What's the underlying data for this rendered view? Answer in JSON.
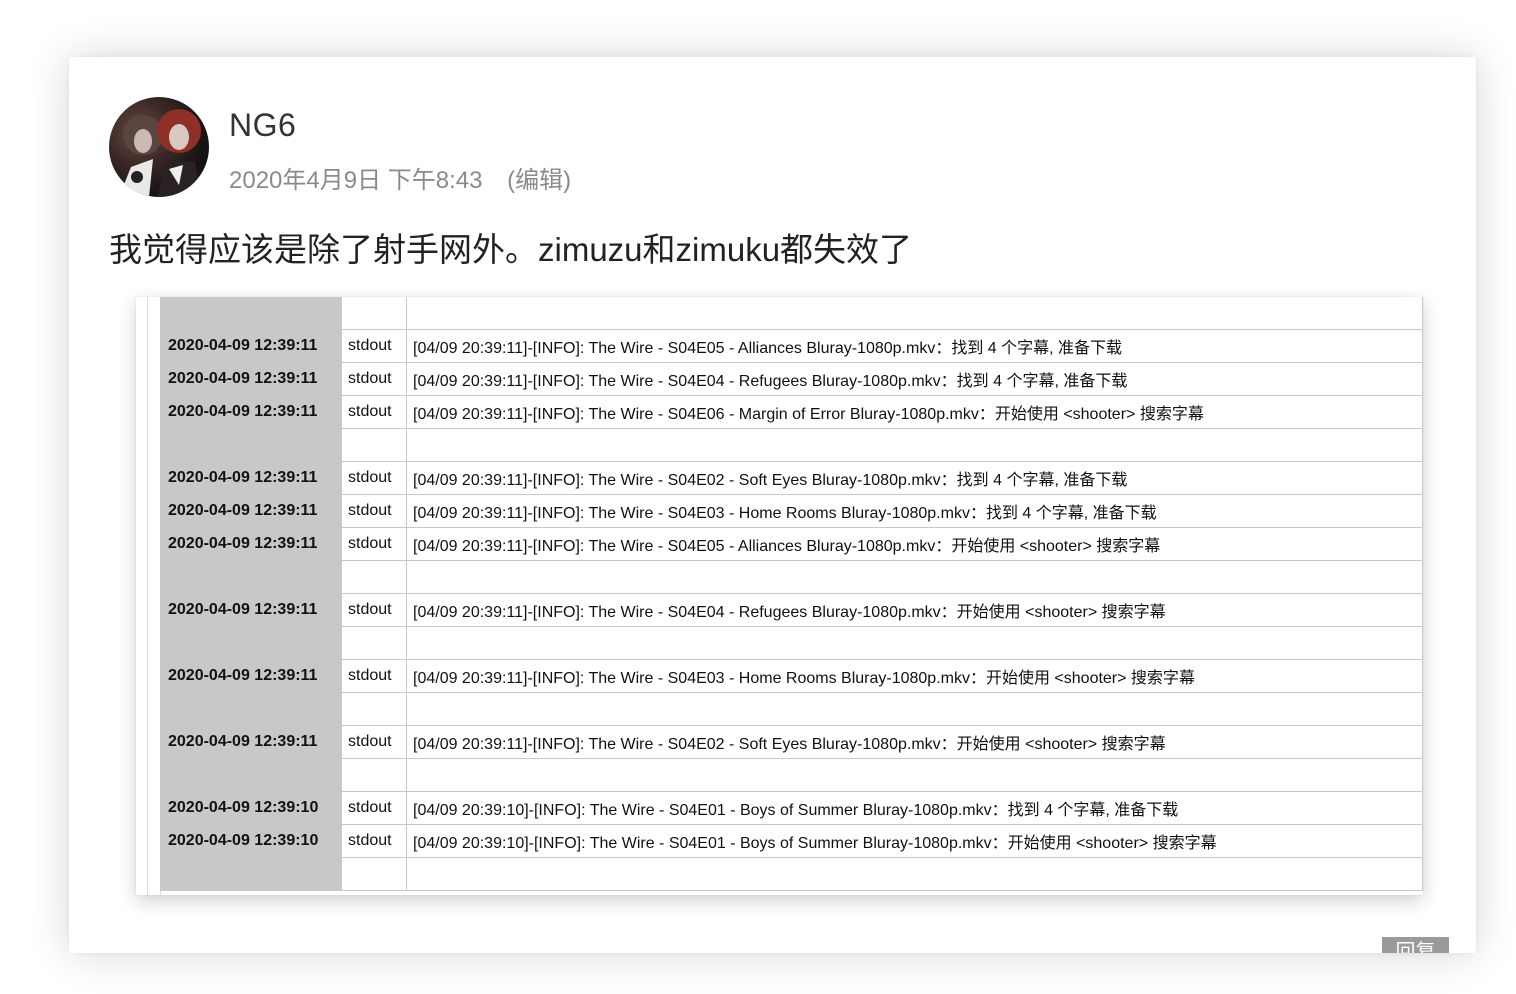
{
  "post": {
    "username": "NG6",
    "timestamp": "2020年4月9日 下午8:43",
    "edit_label": "(编辑)",
    "comment": "我觉得应该是除了射手网外。zimuzu和zimuku都失效了",
    "reply_label": "回复"
  },
  "log_rows": [
    {
      "ts": "",
      "src": "",
      "msg": ""
    },
    {
      "ts": "2020-04-09 12:39:11",
      "src": "stdout",
      "msg": "[04/09 20:39:11]-[INFO]: The Wire - S04E05 - Alliances Bluray-1080p.mkv：找到 4 个字幕, 准备下载"
    },
    {
      "ts": "2020-04-09 12:39:11",
      "src": "stdout",
      "msg": "[04/09 20:39:11]-[INFO]: The Wire - S04E04 - Refugees Bluray-1080p.mkv：找到 4 个字幕, 准备下载"
    },
    {
      "ts": "2020-04-09 12:39:11",
      "src": "stdout",
      "msg": "[04/09 20:39:11]-[INFO]: The Wire - S04E06 - Margin of Error Bluray-1080p.mkv：开始使用 <shooter> 搜索字幕"
    },
    {
      "ts": "",
      "src": "",
      "msg": ""
    },
    {
      "ts": "2020-04-09 12:39:11",
      "src": "stdout",
      "msg": "[04/09 20:39:11]-[INFO]: The Wire - S04E02 - Soft Eyes Bluray-1080p.mkv：找到 4 个字幕, 准备下载"
    },
    {
      "ts": "2020-04-09 12:39:11",
      "src": "stdout",
      "msg": "[04/09 20:39:11]-[INFO]: The Wire - S04E03 - Home Rooms Bluray-1080p.mkv：找到 4 个字幕, 准备下载"
    },
    {
      "ts": "2020-04-09 12:39:11",
      "src": "stdout",
      "msg": "[04/09 20:39:11]-[INFO]: The Wire - S04E05 - Alliances Bluray-1080p.mkv：开始使用 <shooter> 搜索字幕"
    },
    {
      "ts": "",
      "src": "",
      "msg": ""
    },
    {
      "ts": "2020-04-09 12:39:11",
      "src": "stdout",
      "msg": "[04/09 20:39:11]-[INFO]: The Wire - S04E04 - Refugees Bluray-1080p.mkv：开始使用 <shooter> 搜索字幕"
    },
    {
      "ts": "",
      "src": "",
      "msg": ""
    },
    {
      "ts": "2020-04-09 12:39:11",
      "src": "stdout",
      "msg": "[04/09 20:39:11]-[INFO]: The Wire - S04E03 - Home Rooms Bluray-1080p.mkv：开始使用 <shooter> 搜索字幕"
    },
    {
      "ts": "",
      "src": "",
      "msg": ""
    },
    {
      "ts": "2020-04-09 12:39:11",
      "src": "stdout",
      "msg": "[04/09 20:39:11]-[INFO]: The Wire - S04E02 - Soft Eyes Bluray-1080p.mkv：开始使用 <shooter> 搜索字幕"
    },
    {
      "ts": "",
      "src": "",
      "msg": ""
    },
    {
      "ts": "2020-04-09 12:39:10",
      "src": "stdout",
      "msg": "[04/09 20:39:10]-[INFO]: The Wire - S04E01 - Boys of Summer Bluray-1080p.mkv：找到 4 个字幕, 准备下载"
    },
    {
      "ts": "2020-04-09 12:39:10",
      "src": "stdout",
      "msg": "[04/09 20:39:10]-[INFO]: The Wire - S04E01 - Boys of Summer Bluray-1080p.mkv：开始使用 <shooter> 搜索字幕"
    },
    {
      "ts": "",
      "src": "",
      "msg": ""
    }
  ]
}
